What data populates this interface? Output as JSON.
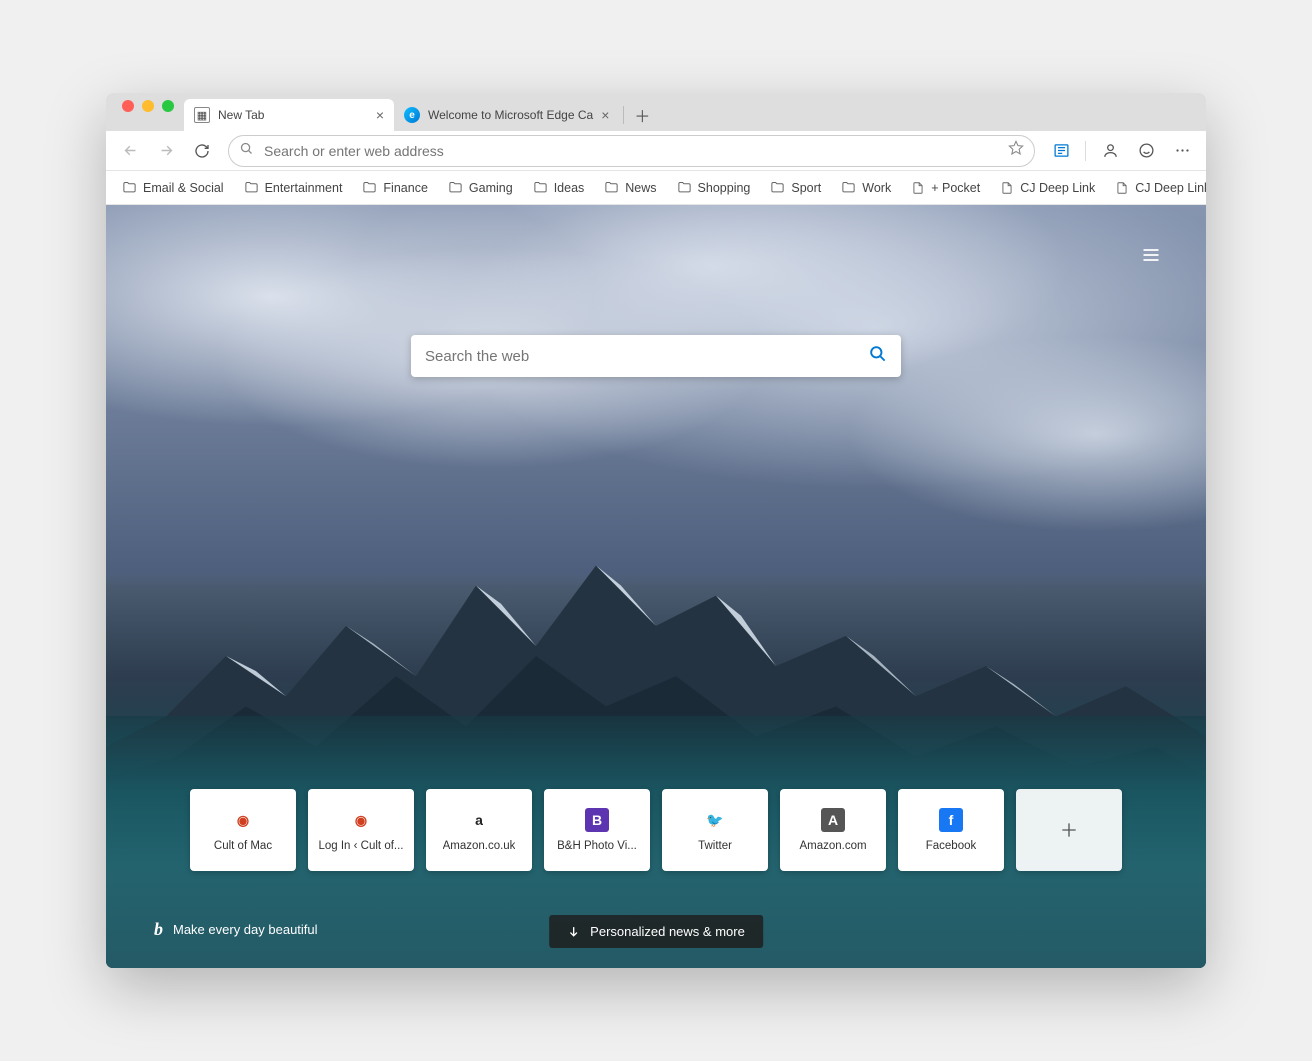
{
  "tabs": [
    {
      "label": "New Tab",
      "active": true
    },
    {
      "label": "Welcome to Microsoft Edge Ca",
      "active": false
    }
  ],
  "omnibox": {
    "placeholder": "Search or enter web address"
  },
  "bookmarks": [
    {
      "label": "Email & Social",
      "type": "folder"
    },
    {
      "label": "Entertainment",
      "type": "folder"
    },
    {
      "label": "Finance",
      "type": "folder"
    },
    {
      "label": "Gaming",
      "type": "folder"
    },
    {
      "label": "Ideas",
      "type": "folder"
    },
    {
      "label": "News",
      "type": "folder"
    },
    {
      "label": "Shopping",
      "type": "folder"
    },
    {
      "label": "Sport",
      "type": "folder"
    },
    {
      "label": "Work",
      "type": "folder"
    },
    {
      "label": "+ Pocket",
      "type": "page"
    },
    {
      "label": "CJ Deep Link",
      "type": "page"
    },
    {
      "label": "CJ Deep Link",
      "type": "page"
    }
  ],
  "newtab_search": {
    "placeholder": "Search the web"
  },
  "tiles": [
    {
      "label": "Cult of Mac",
      "icon_bg": "#ffffff",
      "icon_fg": "#d04020",
      "letter": "◉"
    },
    {
      "label": "Log In ‹ Cult of...",
      "icon_bg": "#ffffff",
      "icon_fg": "#d04020",
      "letter": "◉"
    },
    {
      "label": "Amazon.co.uk",
      "icon_bg": "#ffffff",
      "icon_fg": "#222",
      "letter": "a"
    },
    {
      "label": "B&H Photo Vi...",
      "icon_bg": "#5e35b1",
      "icon_fg": "#fff",
      "letter": "B"
    },
    {
      "label": "Twitter",
      "icon_bg": "#ffffff",
      "icon_fg": "#1da1f2",
      "letter": "🐦"
    },
    {
      "label": "Amazon.com",
      "icon_bg": "#555",
      "icon_fg": "#fff",
      "letter": "A"
    },
    {
      "label": "Facebook",
      "icon_bg": "#1877f2",
      "icon_fg": "#fff",
      "letter": "f"
    }
  ],
  "bing_tagline": "Make every day beautiful",
  "news_button": "Personalized news & more"
}
